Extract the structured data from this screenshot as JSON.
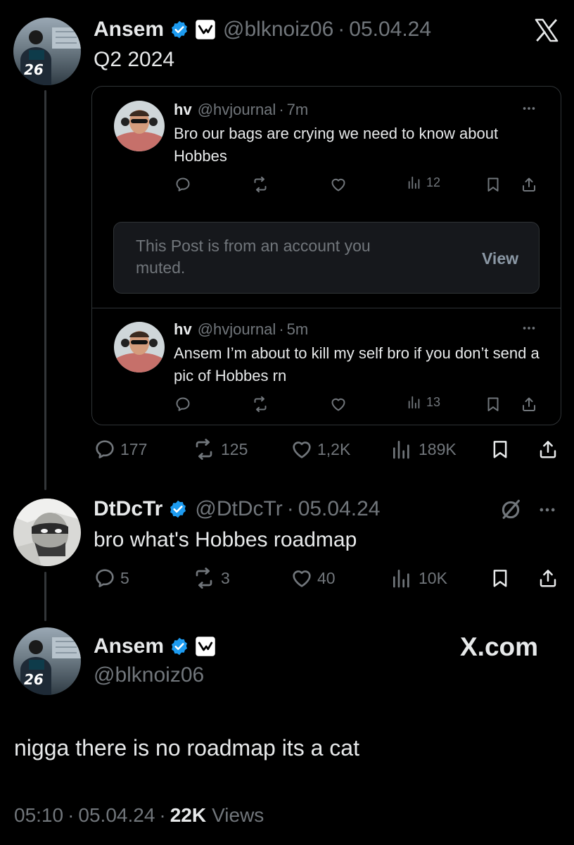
{
  "main_post": {
    "name": "Ansem",
    "handle": "@blknoiz06",
    "date": "05.04.24",
    "text": "Q2 2024",
    "jersey_number": "26",
    "stats": {
      "replies": "177",
      "reposts": "125",
      "likes": "1,2K",
      "views": "189K"
    }
  },
  "quoted": {
    "tweet1": {
      "name": "hv",
      "handle": "@hvjournal",
      "time": "7m",
      "text": "Bro our bags are crying we need to know about Hobbes",
      "views": "12",
      "more": "···"
    },
    "muted_notice": {
      "text": "This Post is from an account you muted.",
      "button": "View"
    },
    "tweet2": {
      "name": "hv",
      "handle": "@hvjournal",
      "time": "5m",
      "text": "Ansem I’m about to kill my self bro if you don’t send a pic of Hobbes rn",
      "views": "13",
      "more": "···"
    }
  },
  "reply": {
    "name": "DtDcTr",
    "handle": "@DtDcTr",
    "date": "05.04.24",
    "text": "bro what's Hobbes roadmap",
    "more": "···",
    "stats": {
      "replies": "5",
      "reposts": "3",
      "likes": "40",
      "views": "10K"
    }
  },
  "final": {
    "name": "Ansem",
    "handle": "@blknoiz06",
    "jersey_number": "26",
    "watermark": "X.com",
    "text": "nigga there is no roadmap its a cat",
    "time": "05:10",
    "date": "05.04.24",
    "views_count": "22K",
    "views_label": "Views"
  },
  "colors": {
    "background": "#000000",
    "text": "#e7e9ea",
    "muted": "#71767b",
    "verified": "#1d9bf0",
    "border": "#2f3336"
  },
  "icons": [
    "x-logo-icon",
    "verified-badge-icon",
    "affiliate-badge-icon",
    "reply-icon",
    "repost-icon",
    "like-icon",
    "views-icon",
    "bookmark-icon",
    "share-icon",
    "mute-icon",
    "more-icon"
  ]
}
